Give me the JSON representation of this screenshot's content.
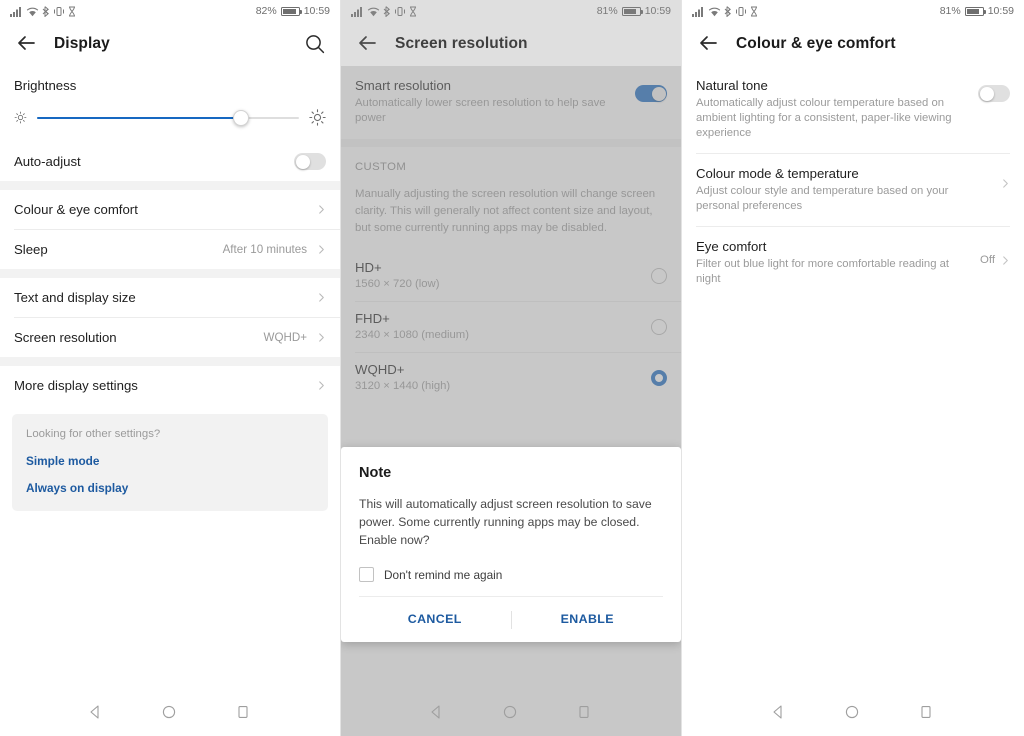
{
  "panels": [
    {
      "id": "display",
      "statusbar": {
        "icons": [
          "signal-icon",
          "wifi-icon",
          "bluetooth-icon",
          "vibrate-icon",
          "hourglass-icon"
        ],
        "battery": "82%",
        "time": "10:59"
      },
      "appbar": {
        "back": "back-arrow-icon",
        "title": "Display",
        "search": "search-icon"
      },
      "brightness": {
        "title": "Brightness",
        "value_percent": 78,
        "low_icon": "brightness-low-icon",
        "high_icon": "brightness-high-icon"
      },
      "auto_adjust": {
        "label": "Auto-adjust",
        "state": "off"
      },
      "rows": [
        {
          "label": "Colour & eye comfort",
          "value": ""
        },
        {
          "label": "Sleep",
          "value": "After 10 minutes"
        },
        {
          "label": "Text and display size",
          "value": ""
        },
        {
          "label": "Screen resolution",
          "value": "WQHD+"
        },
        {
          "label": "More display settings",
          "value": ""
        }
      ],
      "look_card": {
        "hint": "Looking for other settings?",
        "links": [
          "Simple mode",
          "Always on display"
        ]
      }
    },
    {
      "id": "screen-resolution",
      "statusbar": {
        "battery": "81%",
        "time": "10:59"
      },
      "appbar": {
        "back": "back-arrow-icon",
        "title": "Screen resolution"
      },
      "smart_resolution": {
        "title": "Smart resolution",
        "subtitle": "Automatically lower screen resolution to help save power",
        "state": "on"
      },
      "section_label": "CUSTOM",
      "paragraph": "Manually adjusting the screen resolution will change screen clarity. This will generally not affect content size and layout, but some currently running apps may be disabled.",
      "options": [
        {
          "name": "HD+",
          "detail": "1560 × 720 (low)",
          "selected": false
        },
        {
          "name": "FHD+",
          "detail": "2340 × 1080 (medium)",
          "selected": false
        },
        {
          "name": "WQHD+",
          "detail": "3120 × 1440 (high)",
          "selected": true
        }
      ],
      "dialog": {
        "title": "Note",
        "body": "This will automatically adjust screen resolution to save power. Some currently running apps may be closed. Enable now?",
        "checkbox_label": "Don't remind me again",
        "checkbox_checked": false,
        "cancel": "CANCEL",
        "confirm": "ENABLE"
      }
    },
    {
      "id": "colour-eye-comfort",
      "statusbar": {
        "battery": "81%",
        "time": "10:59"
      },
      "appbar": {
        "back": "back-arrow-icon",
        "title": "Colour & eye comfort"
      },
      "items": [
        {
          "title": "Natural tone",
          "subtitle": "Automatically adjust colour temperature based on ambient lighting for a consistent, paper-like viewing experience",
          "control": "toggle",
          "state": "off",
          "value": ""
        },
        {
          "title": "Colour mode & temperature",
          "subtitle": "Adjust colour style and temperature based on your personal preferences",
          "control": "chevron",
          "value": ""
        },
        {
          "title": "Eye comfort",
          "subtitle": "Filter out blue light for more comfortable reading at night",
          "control": "chevron",
          "value": "Off"
        }
      ]
    }
  ],
  "navbar": {
    "back": "nav-back-icon",
    "home": "nav-home-icon",
    "recents": "nav-recents-icon"
  },
  "colors": {
    "accent": "#1668c1",
    "link": "#1d5aa0",
    "divider": "#ececec",
    "section_bg": "#f2f2f2",
    "dim": "#c8c8c8"
  }
}
